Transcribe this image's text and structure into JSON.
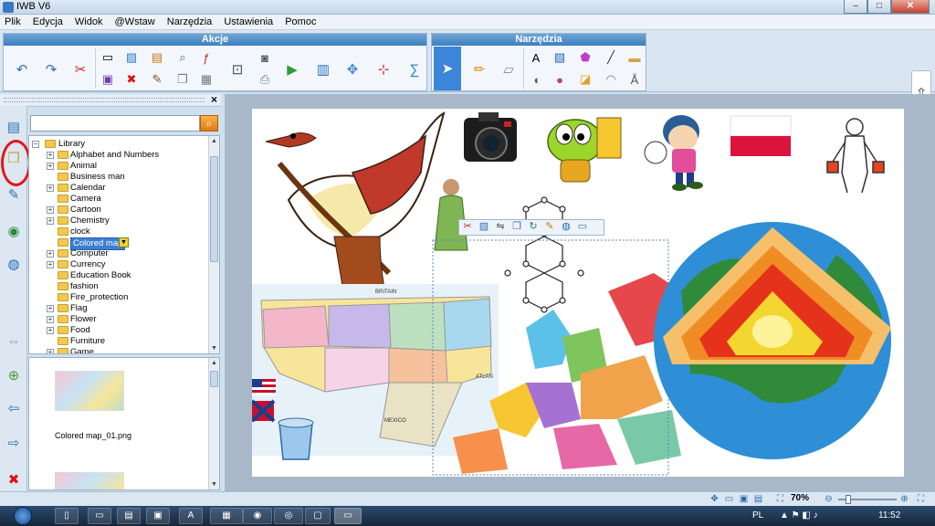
{
  "window": {
    "title": "IWB V6",
    "buttons": {
      "minimize": "–",
      "maximize": "□",
      "close": "✕"
    }
  },
  "menu": [
    "Plik",
    "Edycja",
    "Widok",
    "@Wstaw",
    "Narzędzia",
    "Ustawienia",
    "Pomoc"
  ],
  "toolbar": {
    "akcje_label": "Akcje",
    "narzedzia_label": "Narzędzia",
    "akcje_icons": [
      "undo-icon",
      "redo-icon",
      "cut-icon",
      "shape-icon",
      "save-icon",
      "image-icon",
      "delete-icon",
      "palette-icon",
      "zoom-icon",
      "eraser-icon",
      "flash-icon",
      "copy-icon",
      "screen-capture-icon",
      "camera-icon",
      "print-icon",
      "video-recorder-icon",
      "chart-icon",
      "move-icon",
      "grid-icon",
      "sum-icon"
    ],
    "narzedzia_icons": [
      "select-arrow-icon",
      "pen-icon",
      "eraser-icon",
      "text-icon",
      "color-icon",
      "polygon-icon",
      "line-icon",
      "speaker-icon",
      "paint-icon",
      "stamp-icon",
      "protractor-icon",
      "compass-icon",
      "ruler-icon"
    ]
  },
  "library": {
    "search": {
      "value": "",
      "placeholder": ""
    },
    "root": "Library",
    "items": [
      {
        "label": "Alphabet and Numbers",
        "expandable": true
      },
      {
        "label": "Animal",
        "expandable": true
      },
      {
        "label": "Business  man",
        "expandable": false
      },
      {
        "label": "Calendar",
        "expandable": true
      },
      {
        "label": "Camera",
        "expandable": false
      },
      {
        "label": "Cartoon",
        "expandable": true
      },
      {
        "label": "Chemistry",
        "expandable": true
      },
      {
        "label": "clock",
        "expandable": false
      },
      {
        "label": "Colored map",
        "expandable": false,
        "selected": true
      },
      {
        "label": "Computer",
        "expandable": true
      },
      {
        "label": "Currency",
        "expandable": true
      },
      {
        "label": "Education Book",
        "expandable": false
      },
      {
        "label": "fashion",
        "expandable": false
      },
      {
        "label": "Fire_protection",
        "expandable": false
      },
      {
        "label": "Flag",
        "expandable": true
      },
      {
        "label": "Flower",
        "expandable": true
      },
      {
        "label": "Food",
        "expandable": true
      },
      {
        "label": "Furniture",
        "expandable": false
      },
      {
        "label": "Game",
        "expandable": true
      }
    ],
    "preview_file": "Colored map_01.png"
  },
  "canvas": {
    "map_labels": {
      "britain": "BRITAIN",
      "mexico": "MEXICO",
      "atlantic": "ATLAN"
    },
    "shape_toolbar_icons": [
      "cut-icon",
      "image-icon",
      "flip-icon",
      "layers-icon",
      "rotate-icon",
      "edit-icon",
      "globe-icon",
      "window-icon"
    ]
  },
  "status": {
    "zoom": "70%"
  },
  "taskbar": {
    "lang": "PL",
    "time": "11:52"
  },
  "colors": {
    "accent": "#3d7fc0",
    "selection": "#3b7fd4",
    "highlight_ring": "#e01818"
  }
}
